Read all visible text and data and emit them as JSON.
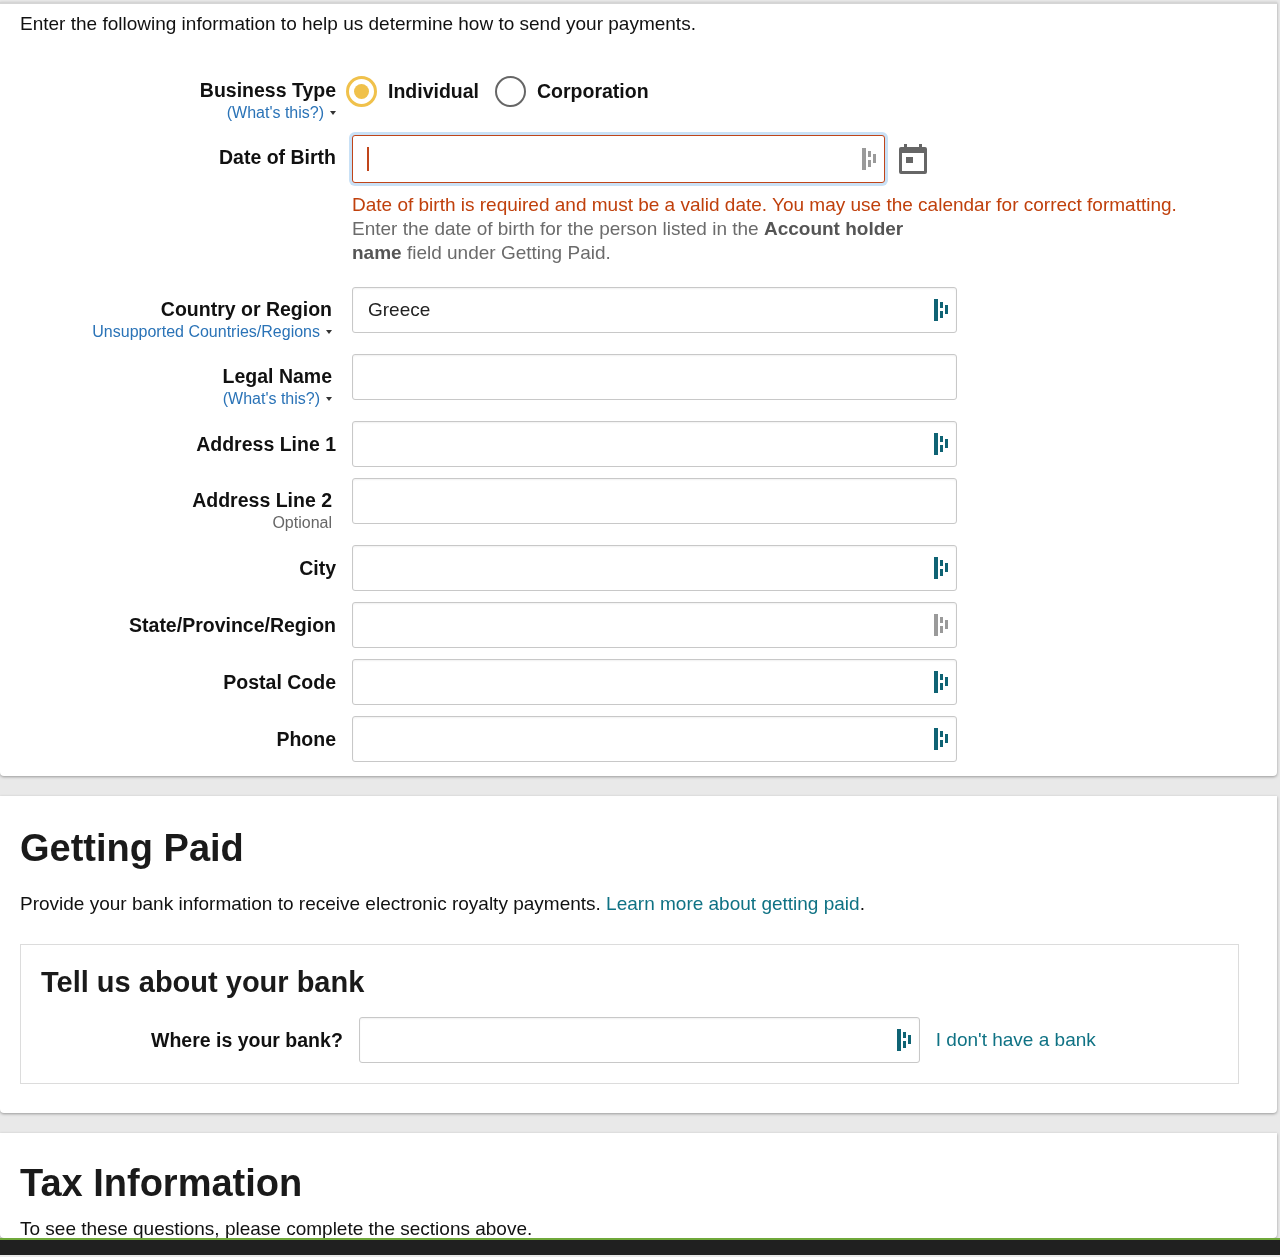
{
  "intro": "Enter the following information to help us determine how to send your payments.",
  "business_type": {
    "label": "Business Type",
    "help_link": "(What's this?)",
    "options": [
      {
        "label": "Individual",
        "selected": true
      },
      {
        "label": "Corporation",
        "selected": false
      }
    ]
  },
  "date_of_birth": {
    "label": "Date of Birth",
    "invalid": true,
    "autofill": {
      "disabled": true
    },
    "error": "Date of birth is required and must be a valid date. You may use the calendar for correct formatting.",
    "hint": "Enter the date of birth for the person listed in the **Account holder**\n**name** field under Getting Paid."
  },
  "fields": [
    {
      "label": "Country or Region",
      "sublabel": {
        "kind": "link",
        "text": "Unsupported Countries/Regions"
      },
      "value": "Greece",
      "autofill": {
        "disabled": false
      }
    },
    {
      "label": "Legal Name",
      "sublabel": {
        "kind": "link",
        "text": "(What's this?)"
      }
    },
    {
      "label": "Address Line 1",
      "autofill": {
        "disabled": false
      }
    },
    {
      "label": "Address Line 2",
      "sublabel": {
        "kind": "note",
        "text": "Optional"
      }
    },
    {
      "label": "City",
      "autofill": {
        "disabled": false
      }
    },
    {
      "label": "State/Province/Region",
      "autofill": {
        "disabled": true
      }
    },
    {
      "label": "Postal Code",
      "autofill": {
        "disabled": false
      }
    },
    {
      "label": "Phone",
      "autofill": {
        "disabled": false
      }
    }
  ],
  "getting_paid": {
    "title": "Getting Paid",
    "text": "Provide your bank information to receive electronic royalty payments.",
    "link": "Learn more about getting paid",
    "text_end": ".",
    "bank": {
      "title": "Tell us about your bank",
      "label": "Where is your bank?",
      "autofill": {
        "disabled": false
      },
      "link": "I don't have a bank"
    }
  },
  "tax": {
    "title": "Tax Information",
    "text": "To see these questions, please complete the sections above."
  }
}
